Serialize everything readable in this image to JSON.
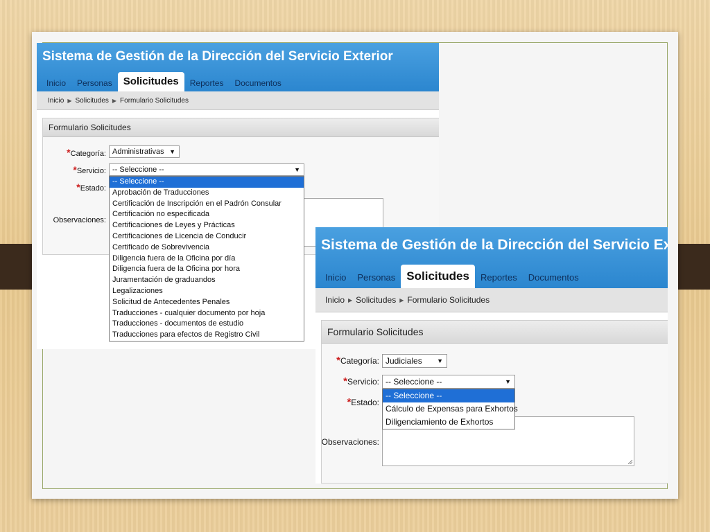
{
  "app_title": "Sistema de Gestión de la Dirección del Servicio Exterior",
  "nav": [
    "Inicio",
    "Personas",
    "Solicitudes",
    "Reportes",
    "Documentos"
  ],
  "nav_active": "Solicitudes",
  "breadcrumb": [
    "Inicio",
    "Solicitudes",
    "Formulario Solicitudes"
  ],
  "form_title": "Formulario Solicitudes",
  "labels": {
    "categoria": "Categoría:",
    "servicio": "Servicio:",
    "estado": "Estado:",
    "observaciones": "Observaciones:",
    "required_mark": "*"
  },
  "screen1": {
    "categoria_value": "Administrativas",
    "servicio_value": "-- Seleccione --",
    "options": [
      "-- Seleccione --",
      "Aprobación de Traducciones",
      "Certificación de Inscripción en el Padrón Consular",
      "Certificación no especificada",
      "Certificaciones de Leyes y Prácticas",
      "Certificaciones de Licencia de Conducir",
      "Certificado de Sobrevivencia",
      "Diligencia fuera de la Oficina por día",
      "Diligencia fuera de la Oficina por hora",
      "Juramentación de graduandos",
      "Legalizaciones",
      "Solicitud de Antecedentes Penales",
      "Traducciones - cualquier documento por hoja",
      "Traducciones - documentos de estudio",
      "Traducciones para efectos de Registro Civil"
    ]
  },
  "screen2": {
    "categoria_value": "Judiciales",
    "servicio_value": "-- Seleccione --",
    "options": [
      "-- Seleccione --",
      "Cálculo de Expensas para Exhortos",
      "Diligenciamiento de Exhortos"
    ]
  },
  "icons": {
    "dropdown_arrow": "▼",
    "breadcrumb_sep": "▶"
  },
  "colors": {
    "header_blue": "#2b86cf",
    "selected_option": "#1f6fd6",
    "required_red": "#cc1f1f"
  }
}
